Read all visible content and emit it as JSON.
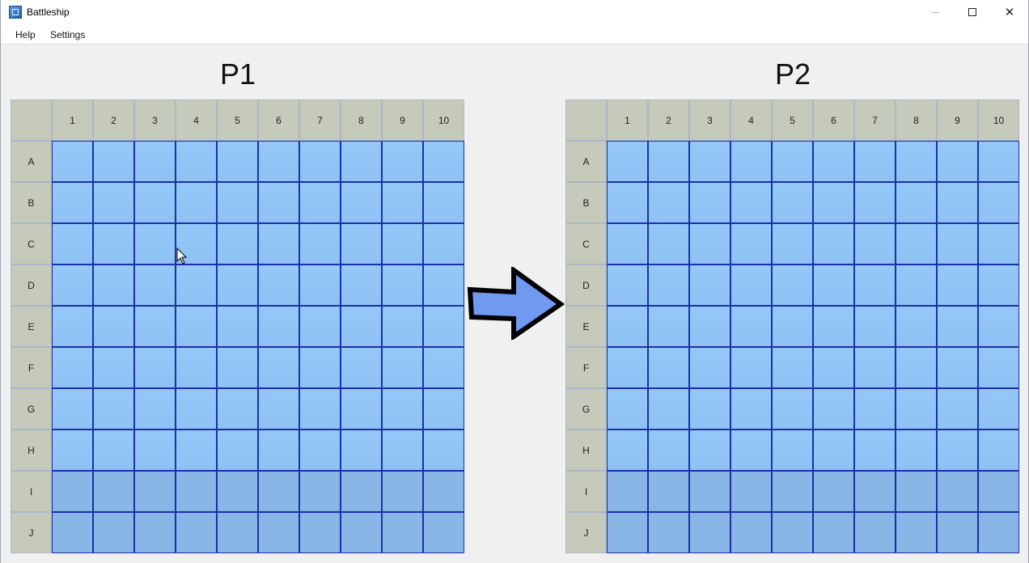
{
  "window": {
    "title": "Battleship",
    "icon": "battleship-app-icon",
    "controls": {
      "minimize": "minimize-icon",
      "maximize": "maximize-icon",
      "close": "✕"
    }
  },
  "menu": {
    "items": [
      {
        "label": "Help"
      },
      {
        "label": "Settings"
      }
    ]
  },
  "players": {
    "p1": {
      "label": "P1"
    },
    "p2": {
      "label": "P2"
    }
  },
  "board": {
    "columns": [
      "1",
      "2",
      "3",
      "4",
      "5",
      "6",
      "7",
      "8",
      "9",
      "10"
    ],
    "rows": [
      "A",
      "B",
      "C",
      "D",
      "E",
      "F",
      "G",
      "H",
      "I",
      "J"
    ]
  },
  "turn_indicator": {
    "icon": "right-arrow-icon",
    "direction": "toward-P2"
  },
  "colors": {
    "water": "#93c8f9",
    "grid_line": "#1e2fa8",
    "header_bg": "#c5cabb",
    "arrow_fill": "#6f9af0"
  }
}
